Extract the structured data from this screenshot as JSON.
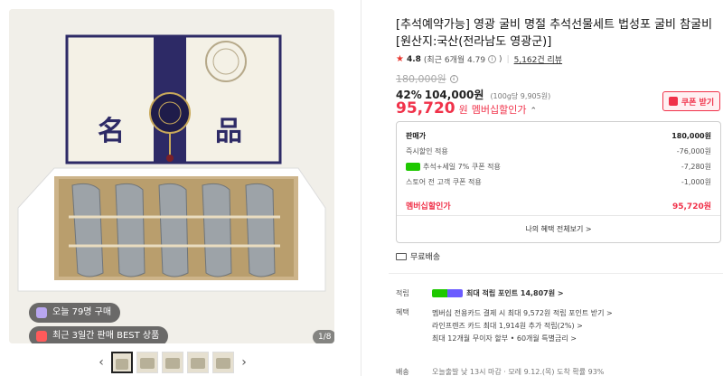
{
  "gallery": {
    "badge_today": "오늘 79명 구매",
    "badge_best": "최근 3일간 판매 BEST 상품",
    "page_counter": "1/8",
    "prev_icon": "chevron-left-icon",
    "next_icon": "chevron-right-icon",
    "thumbnail_count": 5
  },
  "product": {
    "title": "[추석예약가능] 영광 굴비 명절 추석선물세트 법성포 굴비 참굴비 [원산지:국산(전라남도 영광군)]",
    "rating": "4.8",
    "rating_detail": "(최근 6개월 4.79",
    "reviews": "5,162건 리뷰",
    "original_price": "180,000원",
    "discount_rate": "42%",
    "sale_price": "104,000원",
    "unit_price": "(100g당 9,905원)",
    "member_price": "95,720",
    "member_won": "원",
    "member_label": "멤버십할인가",
    "coupon_button": "쿠폰 받기"
  },
  "price_breakdown": {
    "rows": [
      {
        "label": "판매가",
        "value": "180,000원"
      },
      {
        "label": "즉시할인 적용",
        "value": "-76,000원"
      },
      {
        "label": "추석+세일 7% 쿠폰 적용",
        "value": "-7,280원"
      },
      {
        "label": "스토어 전 고객 쿠폰 적용",
        "value": "-1,000원"
      },
      {
        "label": "멤버십할인가",
        "value": "95,720원"
      }
    ],
    "more_link": "나의 혜택 전체보기 >"
  },
  "shipping": {
    "label": "무료배송"
  },
  "points": {
    "label": "적립",
    "text": "최대 적립 포인트 14,807원 >"
  },
  "benefits": {
    "label": "혜택",
    "items": [
      "멤버십 전용카드 결제 시 최대 9,572원 적립 포인트 받기 >",
      "라인프렌즈 카드 최대 1,914원 추가 적립(2%) >",
      "최대 12개월 무이자 할부 • 60개월 특별금리 >"
    ]
  },
  "delivery": {
    "label": "배송",
    "text": "오늘출발 낮 13시 마감 · 모레 9.12.(목) 도착 확률 93%"
  },
  "colors": {
    "accent": "#f0324a",
    "naver_green": "#1ec800",
    "navy": "#2d2a66"
  }
}
